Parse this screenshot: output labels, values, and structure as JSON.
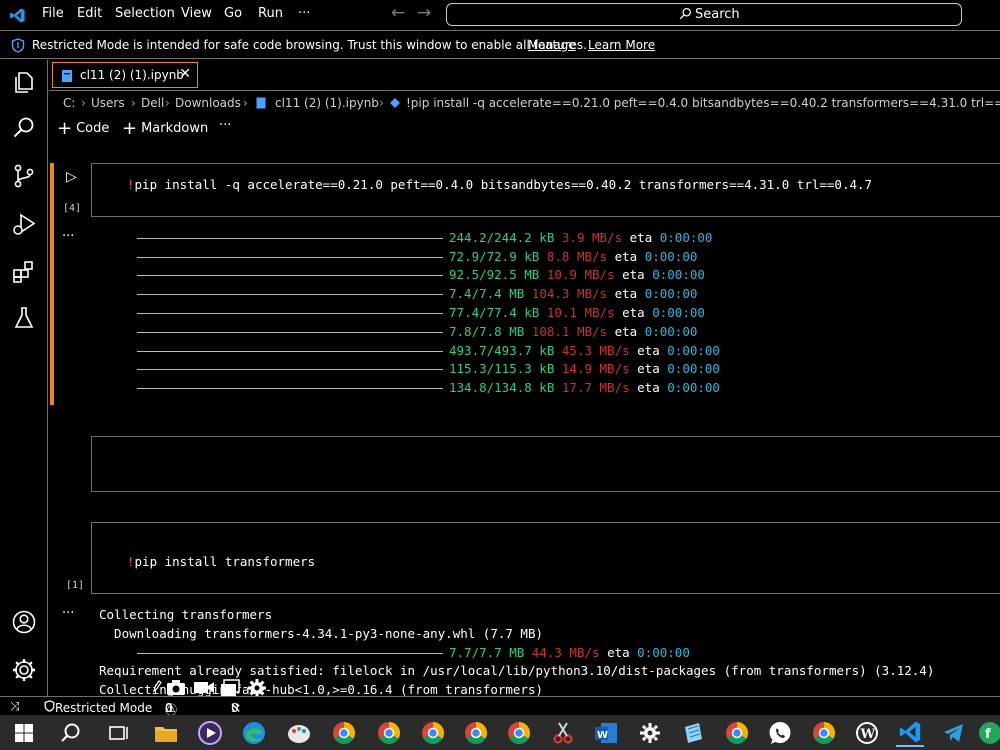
{
  "menu": [
    "File",
    "Edit",
    "Selection",
    "View",
    "Go",
    "Run",
    "···"
  ],
  "search": {
    "label": "Search"
  },
  "banner": {
    "message": "Restricted Mode is intended for safe code browsing. Trust this window to enable all features.",
    "manage": "Manage",
    "learn_more": "Learn More"
  },
  "tab": {
    "label": "cl11 (2) (1).ipynb",
    "close": "✕"
  },
  "breadcrumb": [
    "C:",
    "Users",
    "Dell",
    "Downloads",
    "cl11 (2) (1).ipynb",
    "!pip install -q accelerate==0.21.0 peft==0.4.0 bitsandbytes==0.40.2 transformers==4.31.0 trl==0.4.7"
  ],
  "toolbar": {
    "code": "Code",
    "markdown": "Markdown",
    "more": "···"
  },
  "cell4": {
    "count": "[4]",
    "bang": "!",
    "code": "pip install -q accelerate==0.21.0 peft==0.4.0 bitsandbytes==0.40.2 transformers==4.31.0 trl==0.4.7",
    "output_ellipsis": "···",
    "progress": [
      {
        "size": "244.2/244.2 kB",
        "speed": "3.9 MB/s",
        "eta": "0:00:00"
      },
      {
        "size": "72.9/72.9 kB",
        "speed": "8.8 MB/s",
        "eta": "0:00:00"
      },
      {
        "size": "92.5/92.5 MB",
        "speed": "10.9 MB/s",
        "eta": "0:00:00"
      },
      {
        "size": "7.4/7.4 MB",
        "speed": "104.3 MB/s",
        "eta": "0:00:00"
      },
      {
        "size": "77.4/77.4 kB",
        "speed": "10.1 MB/s",
        "eta": "0:00:00"
      },
      {
        "size": "7.8/7.8 MB",
        "speed": "108.1 MB/s",
        "eta": "0:00:00"
      },
      {
        "size": "493.7/493.7 kB",
        "speed": "45.3 MB/s",
        "eta": "0:00:00"
      },
      {
        "size": "115.3/115.3 kB",
        "speed": "14.9 MB/s",
        "eta": "0:00:00"
      },
      {
        "size": "134.8/134.8 kB",
        "speed": "17.7 MB/s",
        "eta": "0:00:00"
      }
    ],
    "eta_label": "eta"
  },
  "cell1": {
    "count": "[1]",
    "bang": "!",
    "code": "pip install transformers",
    "output_ellipsis": "···",
    "lines": [
      "Collecting transformers",
      "  Downloading transformers-4.34.1-py3-none-any.whl (7.7 MB)"
    ],
    "progress": {
      "size": "7.7/7.7 MB",
      "speed": "44.3 MB/s",
      "eta": "0:00:00"
    },
    "line_req": "Requirement already satisfied: filelock in /usr/local/lib/python3.10/dist-packages (from transformers) (3.12.4)",
    "line_partial": "Collecting huggingface-hub<1.0,>=0.16.4 (from transformers)"
  },
  "status": {
    "remote": "⤨",
    "restricted": "Restricted Mode",
    "errors": "0",
    "warnings": "0",
    "ports": "0"
  },
  "colors": {
    "accent_border": "#f38518",
    "progress_green": "#23d18b",
    "speed_red": "#cd3131",
    "eta_cyan": "#29b8db",
    "bang_red": "#f14c4c"
  }
}
